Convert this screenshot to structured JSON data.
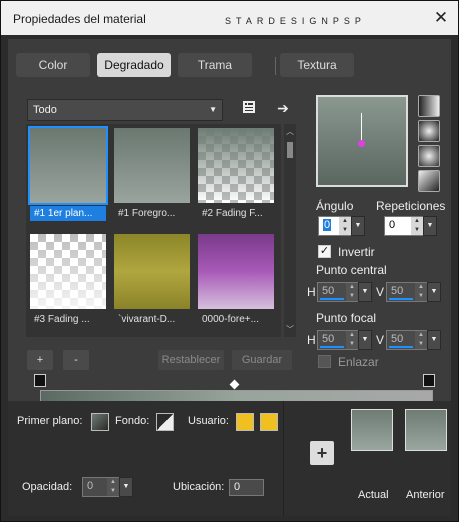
{
  "window": {
    "title": "Propiedades del material",
    "watermark": "STARDESIGNPSP",
    "close": "✕"
  },
  "tabs": [
    "Color",
    "Degradado",
    "Trama",
    "Textura"
  ],
  "active_tab": "Degradado",
  "category": {
    "value": "Todo"
  },
  "swatches": [
    {
      "label": "#1 1er plan...",
      "style": "sage-down",
      "selected": true
    },
    {
      "label": "#1 Foregro...",
      "style": "sage-down",
      "selected": false
    },
    {
      "label": "#2 Fading F...",
      "style": "fade-sage",
      "selected": false
    },
    {
      "label": "#3 Fading ...",
      "style": "fade-gray",
      "selected": false
    },
    {
      "label": "`vivarant-D...",
      "style": "olive",
      "selected": false
    },
    {
      "label": "0000-fore+...",
      "style": "purple",
      "selected": false
    }
  ],
  "buttons": {
    "add": "+",
    "remove": "-",
    "reset": "Restablecer",
    "save": "Guardar"
  },
  "angle": {
    "label": "Ángulo",
    "value": "0"
  },
  "repeats": {
    "label": "Repeticiones",
    "value": "0"
  },
  "invert": {
    "label": "Invertir",
    "checked": true
  },
  "center": {
    "label": "Punto central",
    "h_label": "H",
    "h_value": "50",
    "v_label": "V",
    "v_value": "50"
  },
  "focal": {
    "label": "Punto focal",
    "h_label": "H",
    "h_value": "50",
    "v_label": "V",
    "v_value": "50"
  },
  "link": {
    "label": "Enlazar",
    "checked": false
  },
  "bottom": {
    "foreground_label": "Primer plano:",
    "background_label": "Fondo:",
    "user_label": "Usuario:",
    "opacity_label": "Opacidad:",
    "opacity_value": "0",
    "location_label": "Ubicación:",
    "location_value": "0",
    "plus": "+",
    "current_label": "Actual",
    "previous_label": "Anterior"
  },
  "colors": {
    "accent": "#1e90ff",
    "user": "#f0c020",
    "sage": "#6e7c74"
  }
}
